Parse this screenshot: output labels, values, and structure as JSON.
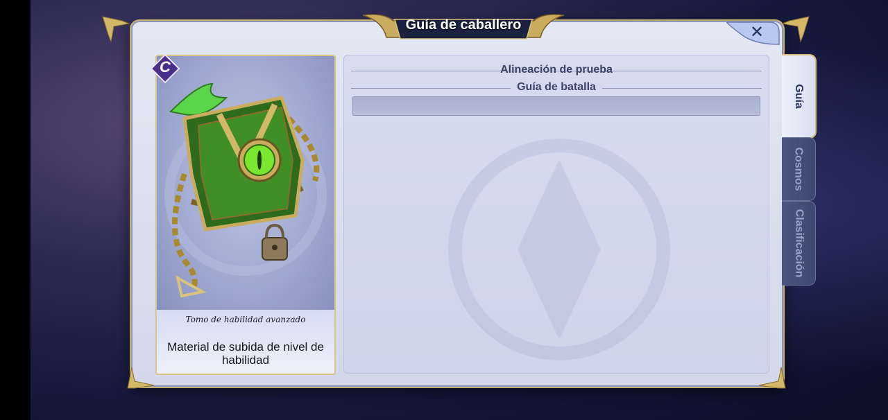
{
  "window": {
    "title": "Guía de caballero",
    "close_icon": "close-icon"
  },
  "item": {
    "rank": "C",
    "name": "Tomo de habilidad avanzado",
    "description": "Material de subida de nivel de habilidad",
    "art_icon": "chained-tome-icon"
  },
  "content": {
    "section_title": "Alineación de prueba",
    "subsection_title": "Guía de batalla"
  },
  "tabs": [
    {
      "label": "Guía",
      "active": true
    },
    {
      "label": "Cosmos",
      "active": false
    },
    {
      "label": "Clasificación",
      "active": false
    }
  ],
  "colors": {
    "gold_trim": "#d4bd7a",
    "panel_bg": "#dde2f1",
    "rank_badge": "#4a2f8a"
  }
}
